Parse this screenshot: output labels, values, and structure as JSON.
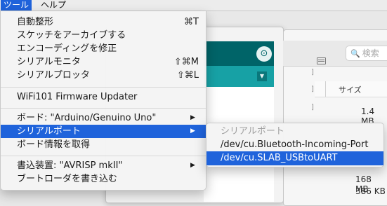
{
  "menubar": {
    "tools_label": "ツール",
    "help_label": "ヘルプ"
  },
  "tools_menu": {
    "items": [
      {
        "label": "自動整形",
        "shortcut": "⌘T"
      },
      {
        "label": "スケッチをアーカイブする",
        "shortcut": ""
      },
      {
        "label": "エンコーディングを修正",
        "shortcut": ""
      },
      {
        "label": "シリアルモニタ",
        "shortcut": "⇧⌘M"
      },
      {
        "label": "シリアルプロッタ",
        "shortcut": "⇧⌘L"
      },
      {
        "label": "WiFi101 Firmware Updater",
        "shortcut": ""
      },
      {
        "label": "ボード: \"Arduino/Genuino Uno\"",
        "shortcut": ""
      },
      {
        "label": "シリアルポート",
        "shortcut": ""
      },
      {
        "label": "ボード情報を取得",
        "shortcut": ""
      },
      {
        "label": "書込装置: \"AVRISP mkII\"",
        "shortcut": ""
      },
      {
        "label": "ブートローダを書き込む",
        "shortcut": ""
      }
    ],
    "arrow_glyph": "▶"
  },
  "serial_port_submenu": {
    "header": "シリアルポート",
    "items": [
      {
        "label": "/dev/cu.Bluetooth-Incoming-Port"
      },
      {
        "label": "/dev/cu.SLAB_USBtoUART"
      }
    ]
  },
  "finder": {
    "search_placeholder": "検索",
    "column_size": "サイズ",
    "sizes": [
      "1.4 MB",
      "168 MB",
      "386 KB"
    ]
  },
  "icons": {
    "serial_monitor": "magnifier-icon",
    "tab_menu": "triangle-down-icon"
  },
  "colors": {
    "highlight": "#1f63db",
    "ide_dark": "#006468",
    "ide_light": "#17a1a5"
  }
}
